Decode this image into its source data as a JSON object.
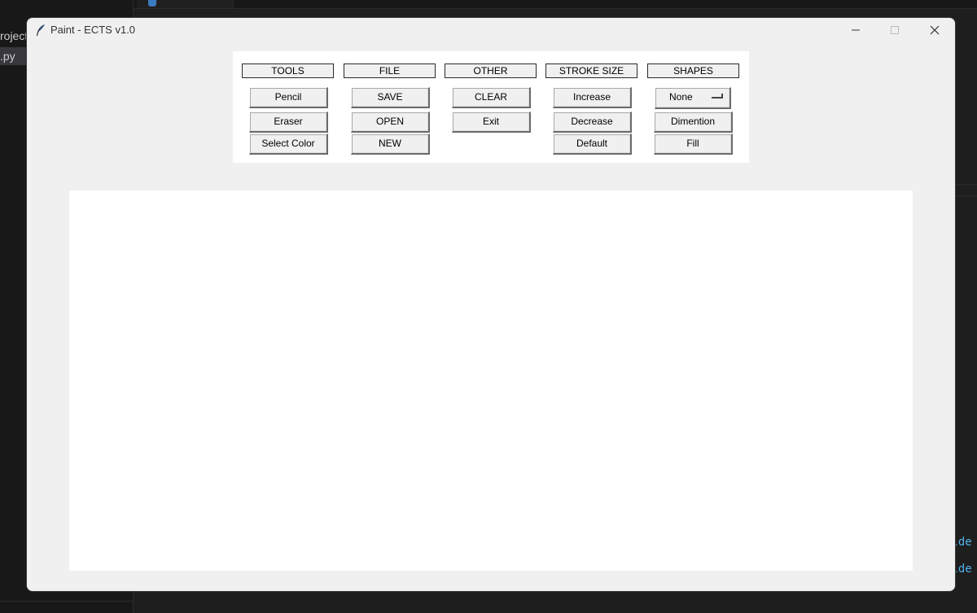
{
  "background": {
    "explorer_items": [
      "roject",
      ".py"
    ],
    "terminal_lines": [
      "olde",
      "olde"
    ]
  },
  "window": {
    "title": "Paint - ECTS v1.0",
    "controls": [
      "minimize-icon",
      "maximize-icon",
      "close-icon"
    ]
  },
  "toolbar": {
    "headers": {
      "tools": "TOOLS",
      "file": "FILE",
      "other": "OTHER",
      "stroke": "STROKE SIZE",
      "shapes": "SHAPES"
    },
    "tools": {
      "pencil": "Pencil",
      "eraser": "Eraser",
      "select_color": "Select Color"
    },
    "file": {
      "save": "SAVE",
      "open": "OPEN",
      "new": "NEW"
    },
    "other": {
      "clear": "CLEAR",
      "exit": "Exit"
    },
    "stroke": {
      "increase": "Increase",
      "decrease": "Decrease",
      "default": "Default"
    },
    "shapes": {
      "selected": "None",
      "dimention": "Dimention",
      "fill": "Fill"
    }
  },
  "colors": {
    "window_bg": "#f0f0f0",
    "canvas_bg": "#ffffff",
    "editor_bg": "#1e1e1e"
  }
}
